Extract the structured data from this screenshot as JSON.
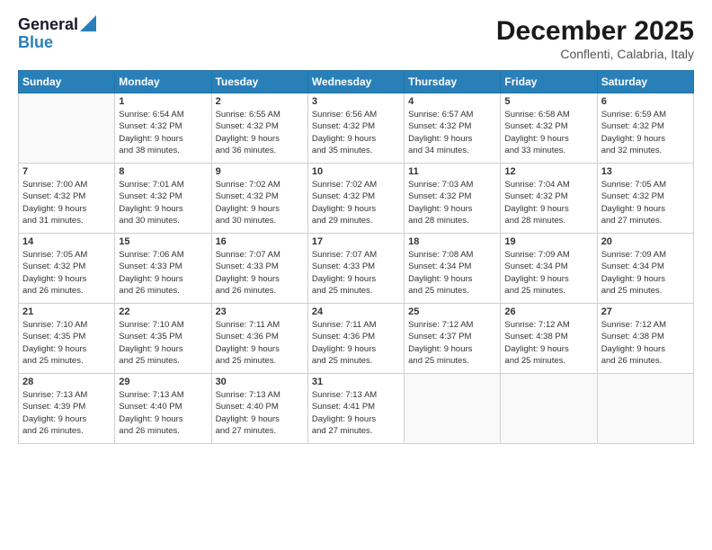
{
  "header": {
    "logo_line1": "General",
    "logo_line2": "Blue",
    "title": "December 2025",
    "subtitle": "Conflenti, Calabria, Italy"
  },
  "days_of_week": [
    "Sunday",
    "Monday",
    "Tuesday",
    "Wednesday",
    "Thursday",
    "Friday",
    "Saturday"
  ],
  "weeks": [
    [
      {
        "day": "",
        "info": ""
      },
      {
        "day": "1",
        "info": "Sunrise: 6:54 AM\nSunset: 4:32 PM\nDaylight: 9 hours\nand 38 minutes."
      },
      {
        "day": "2",
        "info": "Sunrise: 6:55 AM\nSunset: 4:32 PM\nDaylight: 9 hours\nand 36 minutes."
      },
      {
        "day": "3",
        "info": "Sunrise: 6:56 AM\nSunset: 4:32 PM\nDaylight: 9 hours\nand 35 minutes."
      },
      {
        "day": "4",
        "info": "Sunrise: 6:57 AM\nSunset: 4:32 PM\nDaylight: 9 hours\nand 34 minutes."
      },
      {
        "day": "5",
        "info": "Sunrise: 6:58 AM\nSunset: 4:32 PM\nDaylight: 9 hours\nand 33 minutes."
      },
      {
        "day": "6",
        "info": "Sunrise: 6:59 AM\nSunset: 4:32 PM\nDaylight: 9 hours\nand 32 minutes."
      }
    ],
    [
      {
        "day": "7",
        "info": "Sunrise: 7:00 AM\nSunset: 4:32 PM\nDaylight: 9 hours\nand 31 minutes."
      },
      {
        "day": "8",
        "info": "Sunrise: 7:01 AM\nSunset: 4:32 PM\nDaylight: 9 hours\nand 30 minutes."
      },
      {
        "day": "9",
        "info": "Sunrise: 7:02 AM\nSunset: 4:32 PM\nDaylight: 9 hours\nand 30 minutes."
      },
      {
        "day": "10",
        "info": "Sunrise: 7:02 AM\nSunset: 4:32 PM\nDaylight: 9 hours\nand 29 minutes."
      },
      {
        "day": "11",
        "info": "Sunrise: 7:03 AM\nSunset: 4:32 PM\nDaylight: 9 hours\nand 28 minutes."
      },
      {
        "day": "12",
        "info": "Sunrise: 7:04 AM\nSunset: 4:32 PM\nDaylight: 9 hours\nand 28 minutes."
      },
      {
        "day": "13",
        "info": "Sunrise: 7:05 AM\nSunset: 4:32 PM\nDaylight: 9 hours\nand 27 minutes."
      }
    ],
    [
      {
        "day": "14",
        "info": "Sunrise: 7:05 AM\nSunset: 4:32 PM\nDaylight: 9 hours\nand 26 minutes."
      },
      {
        "day": "15",
        "info": "Sunrise: 7:06 AM\nSunset: 4:33 PM\nDaylight: 9 hours\nand 26 minutes."
      },
      {
        "day": "16",
        "info": "Sunrise: 7:07 AM\nSunset: 4:33 PM\nDaylight: 9 hours\nand 26 minutes."
      },
      {
        "day": "17",
        "info": "Sunrise: 7:07 AM\nSunset: 4:33 PM\nDaylight: 9 hours\nand 25 minutes."
      },
      {
        "day": "18",
        "info": "Sunrise: 7:08 AM\nSunset: 4:34 PM\nDaylight: 9 hours\nand 25 minutes."
      },
      {
        "day": "19",
        "info": "Sunrise: 7:09 AM\nSunset: 4:34 PM\nDaylight: 9 hours\nand 25 minutes."
      },
      {
        "day": "20",
        "info": "Sunrise: 7:09 AM\nSunset: 4:34 PM\nDaylight: 9 hours\nand 25 minutes."
      }
    ],
    [
      {
        "day": "21",
        "info": "Sunrise: 7:10 AM\nSunset: 4:35 PM\nDaylight: 9 hours\nand 25 minutes."
      },
      {
        "day": "22",
        "info": "Sunrise: 7:10 AM\nSunset: 4:35 PM\nDaylight: 9 hours\nand 25 minutes."
      },
      {
        "day": "23",
        "info": "Sunrise: 7:11 AM\nSunset: 4:36 PM\nDaylight: 9 hours\nand 25 minutes."
      },
      {
        "day": "24",
        "info": "Sunrise: 7:11 AM\nSunset: 4:36 PM\nDaylight: 9 hours\nand 25 minutes."
      },
      {
        "day": "25",
        "info": "Sunrise: 7:12 AM\nSunset: 4:37 PM\nDaylight: 9 hours\nand 25 minutes."
      },
      {
        "day": "26",
        "info": "Sunrise: 7:12 AM\nSunset: 4:38 PM\nDaylight: 9 hours\nand 25 minutes."
      },
      {
        "day": "27",
        "info": "Sunrise: 7:12 AM\nSunset: 4:38 PM\nDaylight: 9 hours\nand 26 minutes."
      }
    ],
    [
      {
        "day": "28",
        "info": "Sunrise: 7:13 AM\nSunset: 4:39 PM\nDaylight: 9 hours\nand 26 minutes."
      },
      {
        "day": "29",
        "info": "Sunrise: 7:13 AM\nSunset: 4:40 PM\nDaylight: 9 hours\nand 26 minutes."
      },
      {
        "day": "30",
        "info": "Sunrise: 7:13 AM\nSunset: 4:40 PM\nDaylight: 9 hours\nand 27 minutes."
      },
      {
        "day": "31",
        "info": "Sunrise: 7:13 AM\nSunset: 4:41 PM\nDaylight: 9 hours\nand 27 minutes."
      },
      {
        "day": "",
        "info": ""
      },
      {
        "day": "",
        "info": ""
      },
      {
        "day": "",
        "info": ""
      }
    ]
  ]
}
